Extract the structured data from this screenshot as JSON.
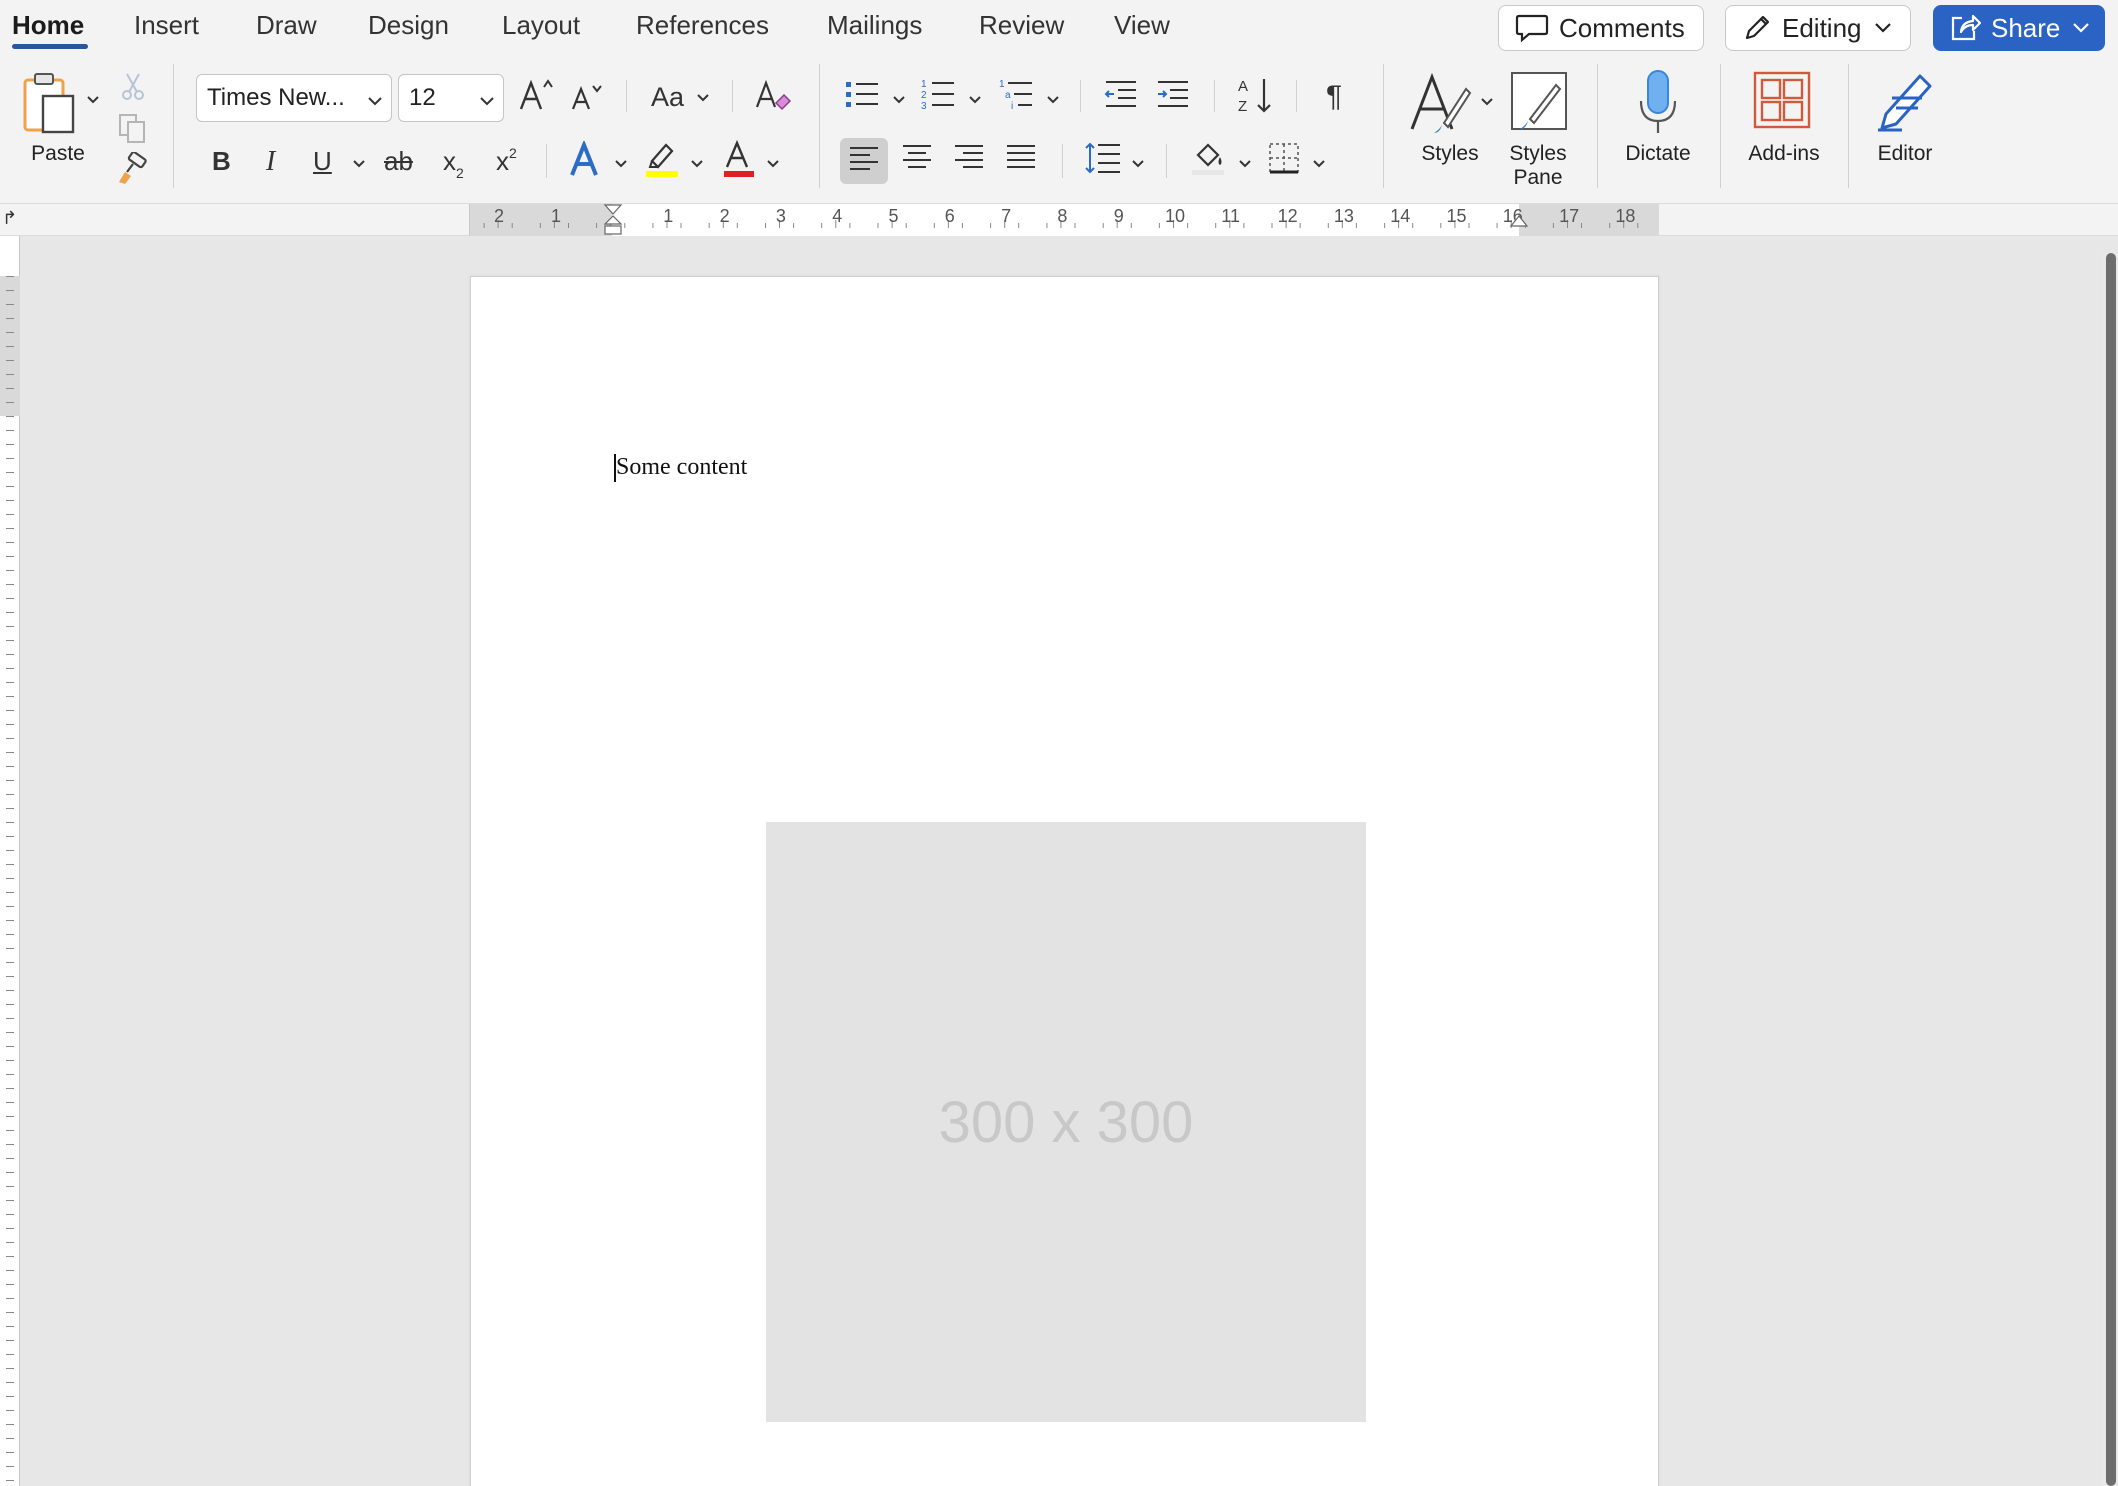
{
  "tabs": [
    "Home",
    "Insert",
    "Draw",
    "Design",
    "Layout",
    "References",
    "Mailings",
    "Review",
    "View"
  ],
  "active_tab": "Home",
  "topbar": {
    "comments_label": "Comments",
    "editing_label": "Editing",
    "share_label": "Share"
  },
  "ribbon": {
    "paste_label": "Paste",
    "font_name": "Times New...",
    "font_size": "12",
    "change_case_label": "Aa",
    "bold_label": "B",
    "italic_label": "I",
    "underline_label": "U",
    "strike_label": "ab",
    "subscript_label": "x",
    "subscript_mark": "2",
    "superscript_label": "x",
    "superscript_mark": "2",
    "pilcrow_label": "¶",
    "styles_label": "Styles",
    "styles_pane_label_1": "Styles",
    "styles_pane_label_2": "Pane",
    "dictate_label": "Dictate",
    "addins_label": "Add-ins",
    "editor_label": "Editor"
  },
  "ruler": {
    "left_numbers": [
      "2",
      "1"
    ],
    "right_numbers": [
      "1",
      "2",
      "3",
      "4",
      "5",
      "6",
      "7",
      "8",
      "9",
      "10",
      "11",
      "12",
      "13",
      "14",
      "15",
      "16",
      "17",
      "18"
    ]
  },
  "document": {
    "text": "Some content",
    "image_placeholder": "300 x 300"
  },
  "colors": {
    "accent": "#2b579a",
    "share_button": "#2b63c4",
    "highlight": "#ffff00",
    "font_color": "#e02020",
    "text_effects": "#2b6cc4",
    "addins": "#d05a3a",
    "dictate": "#3a86d8"
  }
}
